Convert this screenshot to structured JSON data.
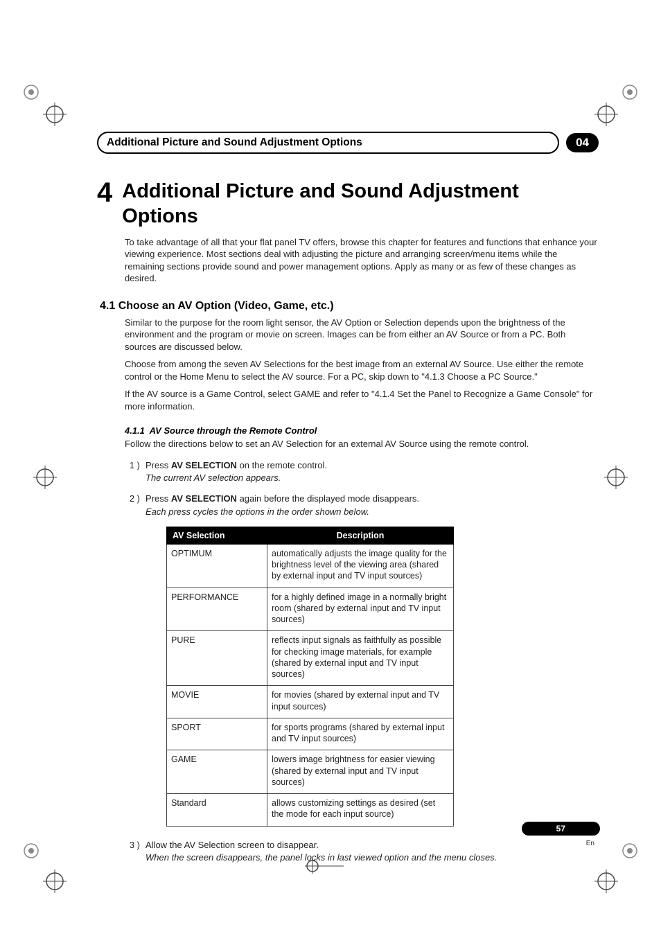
{
  "header": {
    "running_title": "Additional Picture and Sound Adjustment Options",
    "chapter_badge": "04"
  },
  "chapter": {
    "number": "4",
    "title": "Additional Picture and Sound Adjustment Options",
    "intro": "To take advantage of all that your flat panel TV offers, browse this chapter for features and functions that enhance your viewing experience. Most sections deal with adjusting the picture and arranging screen/menu items while the remaining sections provide sound and power management options. Apply as many or as few of these changes as desired."
  },
  "section": {
    "number": "4.1",
    "title": "Choose an AV Option (Video, Game, etc.)",
    "para1": "Similar to the purpose for the room light sensor, the AV Option or Selection depends upon the brightness of the environment and the program or movie on screen. Images can be from either an AV Source or from a PC. Both sources are discussed below.",
    "para2": "Choose from among the seven AV Selections for the best image from an external AV Source. Use either the remote control or the Home Menu to select the AV source. For a PC, skip down to \"4.1.3 Choose a PC Source.\"",
    "para3": "If the AV source is a Game Control, select GAME and refer to \"4.1.4 Set the Panel to Recognize a Game Console\" for more information."
  },
  "subsection": {
    "number": "4.1.1",
    "title": "AV Source through the Remote Control",
    "lead": "Follow the directions below to set an AV Selection for an external AV Source using the remote control."
  },
  "steps": [
    {
      "num": "1 )",
      "text_pre": "Press ",
      "bold": "AV SELECTION",
      "text_post": " on the remote control.",
      "italic": "The current AV selection appears."
    },
    {
      "num": "2 )",
      "text_pre": "Press ",
      "bold": "AV SELECTION",
      "text_post": " again before the displayed mode disappears.",
      "italic": "Each press cycles the options in the order shown below."
    },
    {
      "num": "3 )",
      "text_pre": "Allow the AV Selection screen to disappear.",
      "bold": "",
      "text_post": "",
      "italic": "When the screen disappears, the panel locks in last viewed option and the menu closes."
    }
  ],
  "table": {
    "headers": {
      "col1": "AV Selection",
      "col2": "Description"
    },
    "rows": [
      {
        "sel": "OPTIMUM",
        "desc": "automatically adjusts the image quality for the brightness level of the viewing area (shared by external input and TV input sources)"
      },
      {
        "sel": "PERFORMANCE",
        "desc": "for a highly defined image in a normally bright room (shared by external input and TV input sources)"
      },
      {
        "sel": "PURE",
        "desc": "reflects input signals as faithfully as possible for checking image materials, for example (shared by external input and TV input sources)"
      },
      {
        "sel": "MOVIE",
        "desc": "for movies (shared by external input and TV input sources)"
      },
      {
        "sel": "SPORT",
        "desc": "for sports programs (shared by external input and TV input sources)"
      },
      {
        "sel": "GAME",
        "desc": "lowers image brightness for easier viewing (shared by external input and TV input sources)"
      },
      {
        "sel": "Standard",
        "desc": "allows customizing settings as desired (set the mode for each input source)"
      }
    ]
  },
  "footer": {
    "page_num": "57",
    "lang": "En"
  }
}
